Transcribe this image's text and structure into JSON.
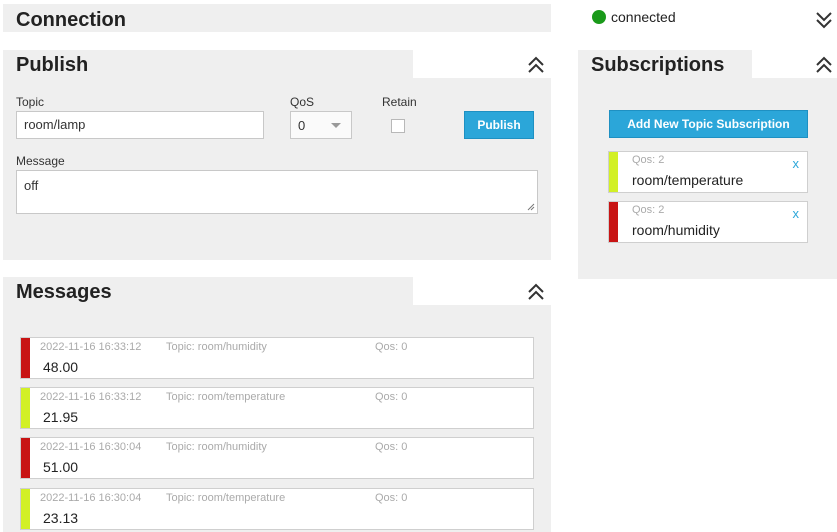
{
  "colors": {
    "panel_bg": "#efefef",
    "accent_blue": "#2ba6d9",
    "status_green": "#1a9a1a",
    "humidity_red": "#c81414",
    "temperature_lime": "#d2f026"
  },
  "connection": {
    "title": "Connection",
    "status": "connected",
    "toggle_icon": "double-chevron-down-icon"
  },
  "publish": {
    "title": "Publish",
    "collapse_icon": "double-chevron-up-icon",
    "topic_label": "Topic",
    "topic_value": "room/lamp",
    "qos_label": "QoS",
    "qos_value": "0",
    "retain_label": "Retain",
    "retain_checked": false,
    "publish_button": "Publish",
    "message_label": "Message",
    "message_value": "off"
  },
  "subscriptions": {
    "title": "Subscriptions",
    "collapse_icon": "double-chevron-up-icon",
    "add_button": "Add New Topic Subscription",
    "items": [
      {
        "qos": "Qos: 2",
        "topic": "room/temperature",
        "color": "#d2f026",
        "remove": "x"
      },
      {
        "qos": "Qos: 2",
        "topic": "room/humidity",
        "color": "#c81414",
        "remove": "x"
      }
    ]
  },
  "messages": {
    "title": "Messages",
    "collapse_icon": "double-chevron-up-icon",
    "items": [
      {
        "time": "2022-11-16 16:33:12",
        "topic": "Topic: room/humidity",
        "qos": "Qos: 0",
        "payload": "48.00",
        "color": "#c81414"
      },
      {
        "time": "2022-11-16 16:33:12",
        "topic": "Topic: room/temperature",
        "qos": "Qos: 0",
        "payload": "21.95",
        "color": "#d2f026"
      },
      {
        "time": "2022-11-16 16:30:04",
        "topic": "Topic: room/humidity",
        "qos": "Qos: 0",
        "payload": "51.00",
        "color": "#c81414"
      },
      {
        "time": "2022-11-16 16:30:04",
        "topic": "Topic: room/temperature",
        "qos": "Qos: 0",
        "payload": "23.13",
        "color": "#d2f026"
      }
    ]
  }
}
